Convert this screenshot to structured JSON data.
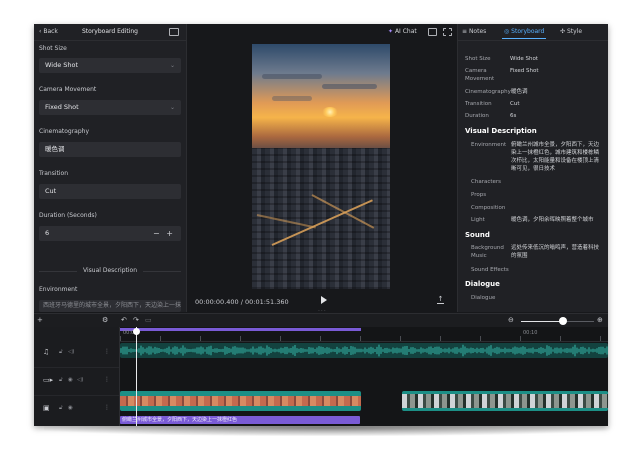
{
  "left_panel": {
    "back_label": "Back",
    "title": "Storyboard Editing",
    "shot_size_label": "Shot Size",
    "shot_size_value": "Wide Shot",
    "camera_movement_label": "Camera Movement",
    "camera_movement_value": "Fixed Shot",
    "cinematography_label": "Cinematography",
    "cinematography_value": "暖色调",
    "transition_label": "Transition",
    "transition_value": "Cut",
    "duration_label": "Duration (Seconds)",
    "duration_value": "6",
    "stepper_label": "− +",
    "visual_description_title": "Visual Description",
    "environment_label": "Environment",
    "environment_value": "西班牙马德里的城市全景，夕阳西下，天边染上一抹橙红色"
  },
  "center": {
    "ai_chat_label": "AI Chat",
    "timecode": "00:00:00.400 / 00:01:51.360"
  },
  "right_panel": {
    "tabs": {
      "notes": "Notes",
      "storyboard": "Storyboard",
      "style": "Style"
    },
    "props": {
      "shot_size": {
        "key": "Shot Size",
        "value": "Wide Shot"
      },
      "camera_movement": {
        "key": "Camera Movement",
        "value": "Fixed Shot"
      },
      "cinematography": {
        "key": "Cinematography",
        "value": "暖色调"
      },
      "transition": {
        "key": "Transition",
        "value": "Cut"
      },
      "duration": {
        "key": "Duration",
        "value": "6s"
      }
    },
    "visual_description_heading": "Visual Description",
    "environment_key": "Environment",
    "environment_value": "俯瞰兰州城市全景，夕阳西下，天边染上一抹橙红色，城市建筑和楼栋鳞次栉比，太阳能量和设备在楼顶上清晰可见，很日技术",
    "characters_key": "Characters",
    "props_key": "Props",
    "composition_key": "Composition",
    "light_key": "Light",
    "light_value": "暖色调，夕阳余晖映照着整个城市",
    "sound_heading": "Sound",
    "background_music_key": "Background Music",
    "background_music_value": "远处传来低沉的嗡鸣声，营造着科技的氛围",
    "sound_effects_key": "Sound Effects",
    "dialogue_heading": "Dialogue",
    "dialogue_key": "Dialogue"
  },
  "timeline": {
    "ruler_start": "00:00",
    "ruler_end": "00:10",
    "zoom_level": 0.57,
    "subtitle_clip_text": "俯瞰兰州城市全景，夕阳西下，天边染上一抹橙红色"
  },
  "colors": {
    "accent_blue": "#5ab2ff",
    "accent_purple": "#7a5bd6",
    "track_teal": "#1c8f86"
  },
  "icons": {
    "back": "chevron-left-icon",
    "ai_chat": "sparkle-icon",
    "play": "play-icon",
    "share": "export-icon",
    "settings": "gear-icon",
    "undo": "undo-icon",
    "redo": "redo-icon",
    "zoom_out": "zoom-out-icon",
    "zoom_in": "zoom-in-icon",
    "music": "music-icon",
    "video": "video-icon",
    "image": "image-icon",
    "lock": "lock-icon",
    "eye": "eye-icon",
    "speaker": "speaker-icon"
  }
}
